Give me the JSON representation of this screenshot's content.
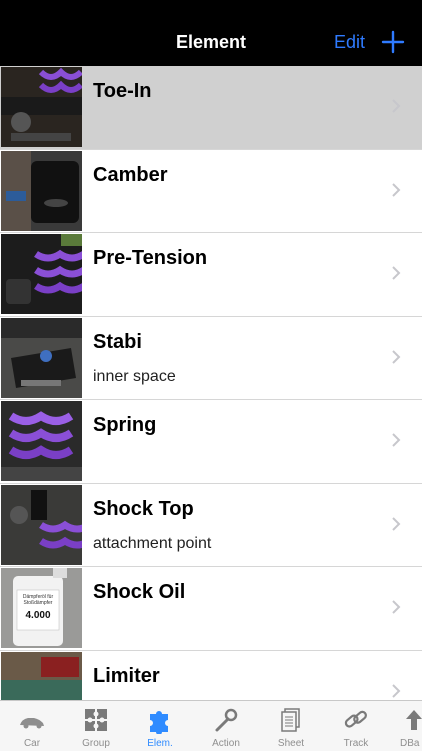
{
  "nav": {
    "title": "Element",
    "edit_label": "Edit",
    "add_icon": "plus-icon"
  },
  "rows": [
    {
      "title": "Toe-In",
      "subtitle": "",
      "selected": true
    },
    {
      "title": "Camber",
      "subtitle": ""
    },
    {
      "title": "Pre-Tension",
      "subtitle": ""
    },
    {
      "title": "Stabi",
      "subtitle": "inner space"
    },
    {
      "title": "Spring",
      "subtitle": ""
    },
    {
      "title": "Shock Top",
      "subtitle": "attachment point"
    },
    {
      "title": "Shock Oil",
      "subtitle": ""
    },
    {
      "title": "Limiter",
      "subtitle": ""
    }
  ],
  "thumb_labels": {
    "oil_line1": "Dämpferöl für",
    "oil_line2": "Stoßdämpfer",
    "oil_value": "4.000"
  },
  "tabs": [
    {
      "label": "Car",
      "icon": "car-icon"
    },
    {
      "label": "Group",
      "icon": "puzzle-grid-icon"
    },
    {
      "label": "Elem.",
      "icon": "puzzle-piece-icon",
      "active": true
    },
    {
      "label": "Action",
      "icon": "wrench-icon"
    },
    {
      "label": "Sheet",
      "icon": "document-stack-icon"
    },
    {
      "label": "Track",
      "icon": "chain-link-icon"
    },
    {
      "label": "DBa",
      "icon": "upload-arrow-icon"
    }
  ],
  "colors": {
    "accent": "#2f7bff",
    "selected_row": "#d0d0d0",
    "tab_active": "#2f8bff",
    "tab_inactive": "#8e8e8e"
  }
}
